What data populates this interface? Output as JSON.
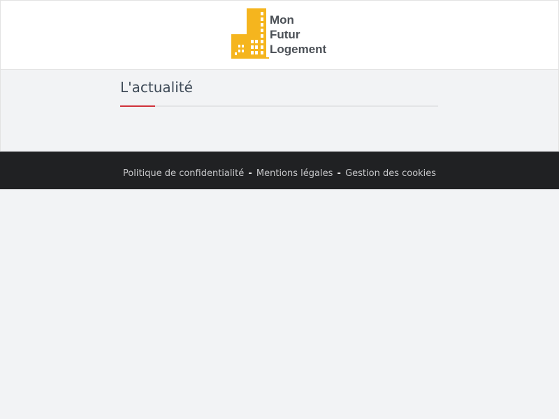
{
  "header": {
    "logo": {
      "lines": [
        "Mon",
        "Futur",
        "Logement"
      ],
      "icon": "buildings-icon",
      "color": "#f5b51e"
    }
  },
  "main": {
    "section_title": "L'actualité",
    "accent_color": "#d0313a"
  },
  "footer": {
    "links": [
      {
        "label": "Politique de confidentialité"
      },
      {
        "label": "Mentions légales"
      },
      {
        "label": "Gestion des cookies"
      }
    ],
    "separator": "-"
  }
}
